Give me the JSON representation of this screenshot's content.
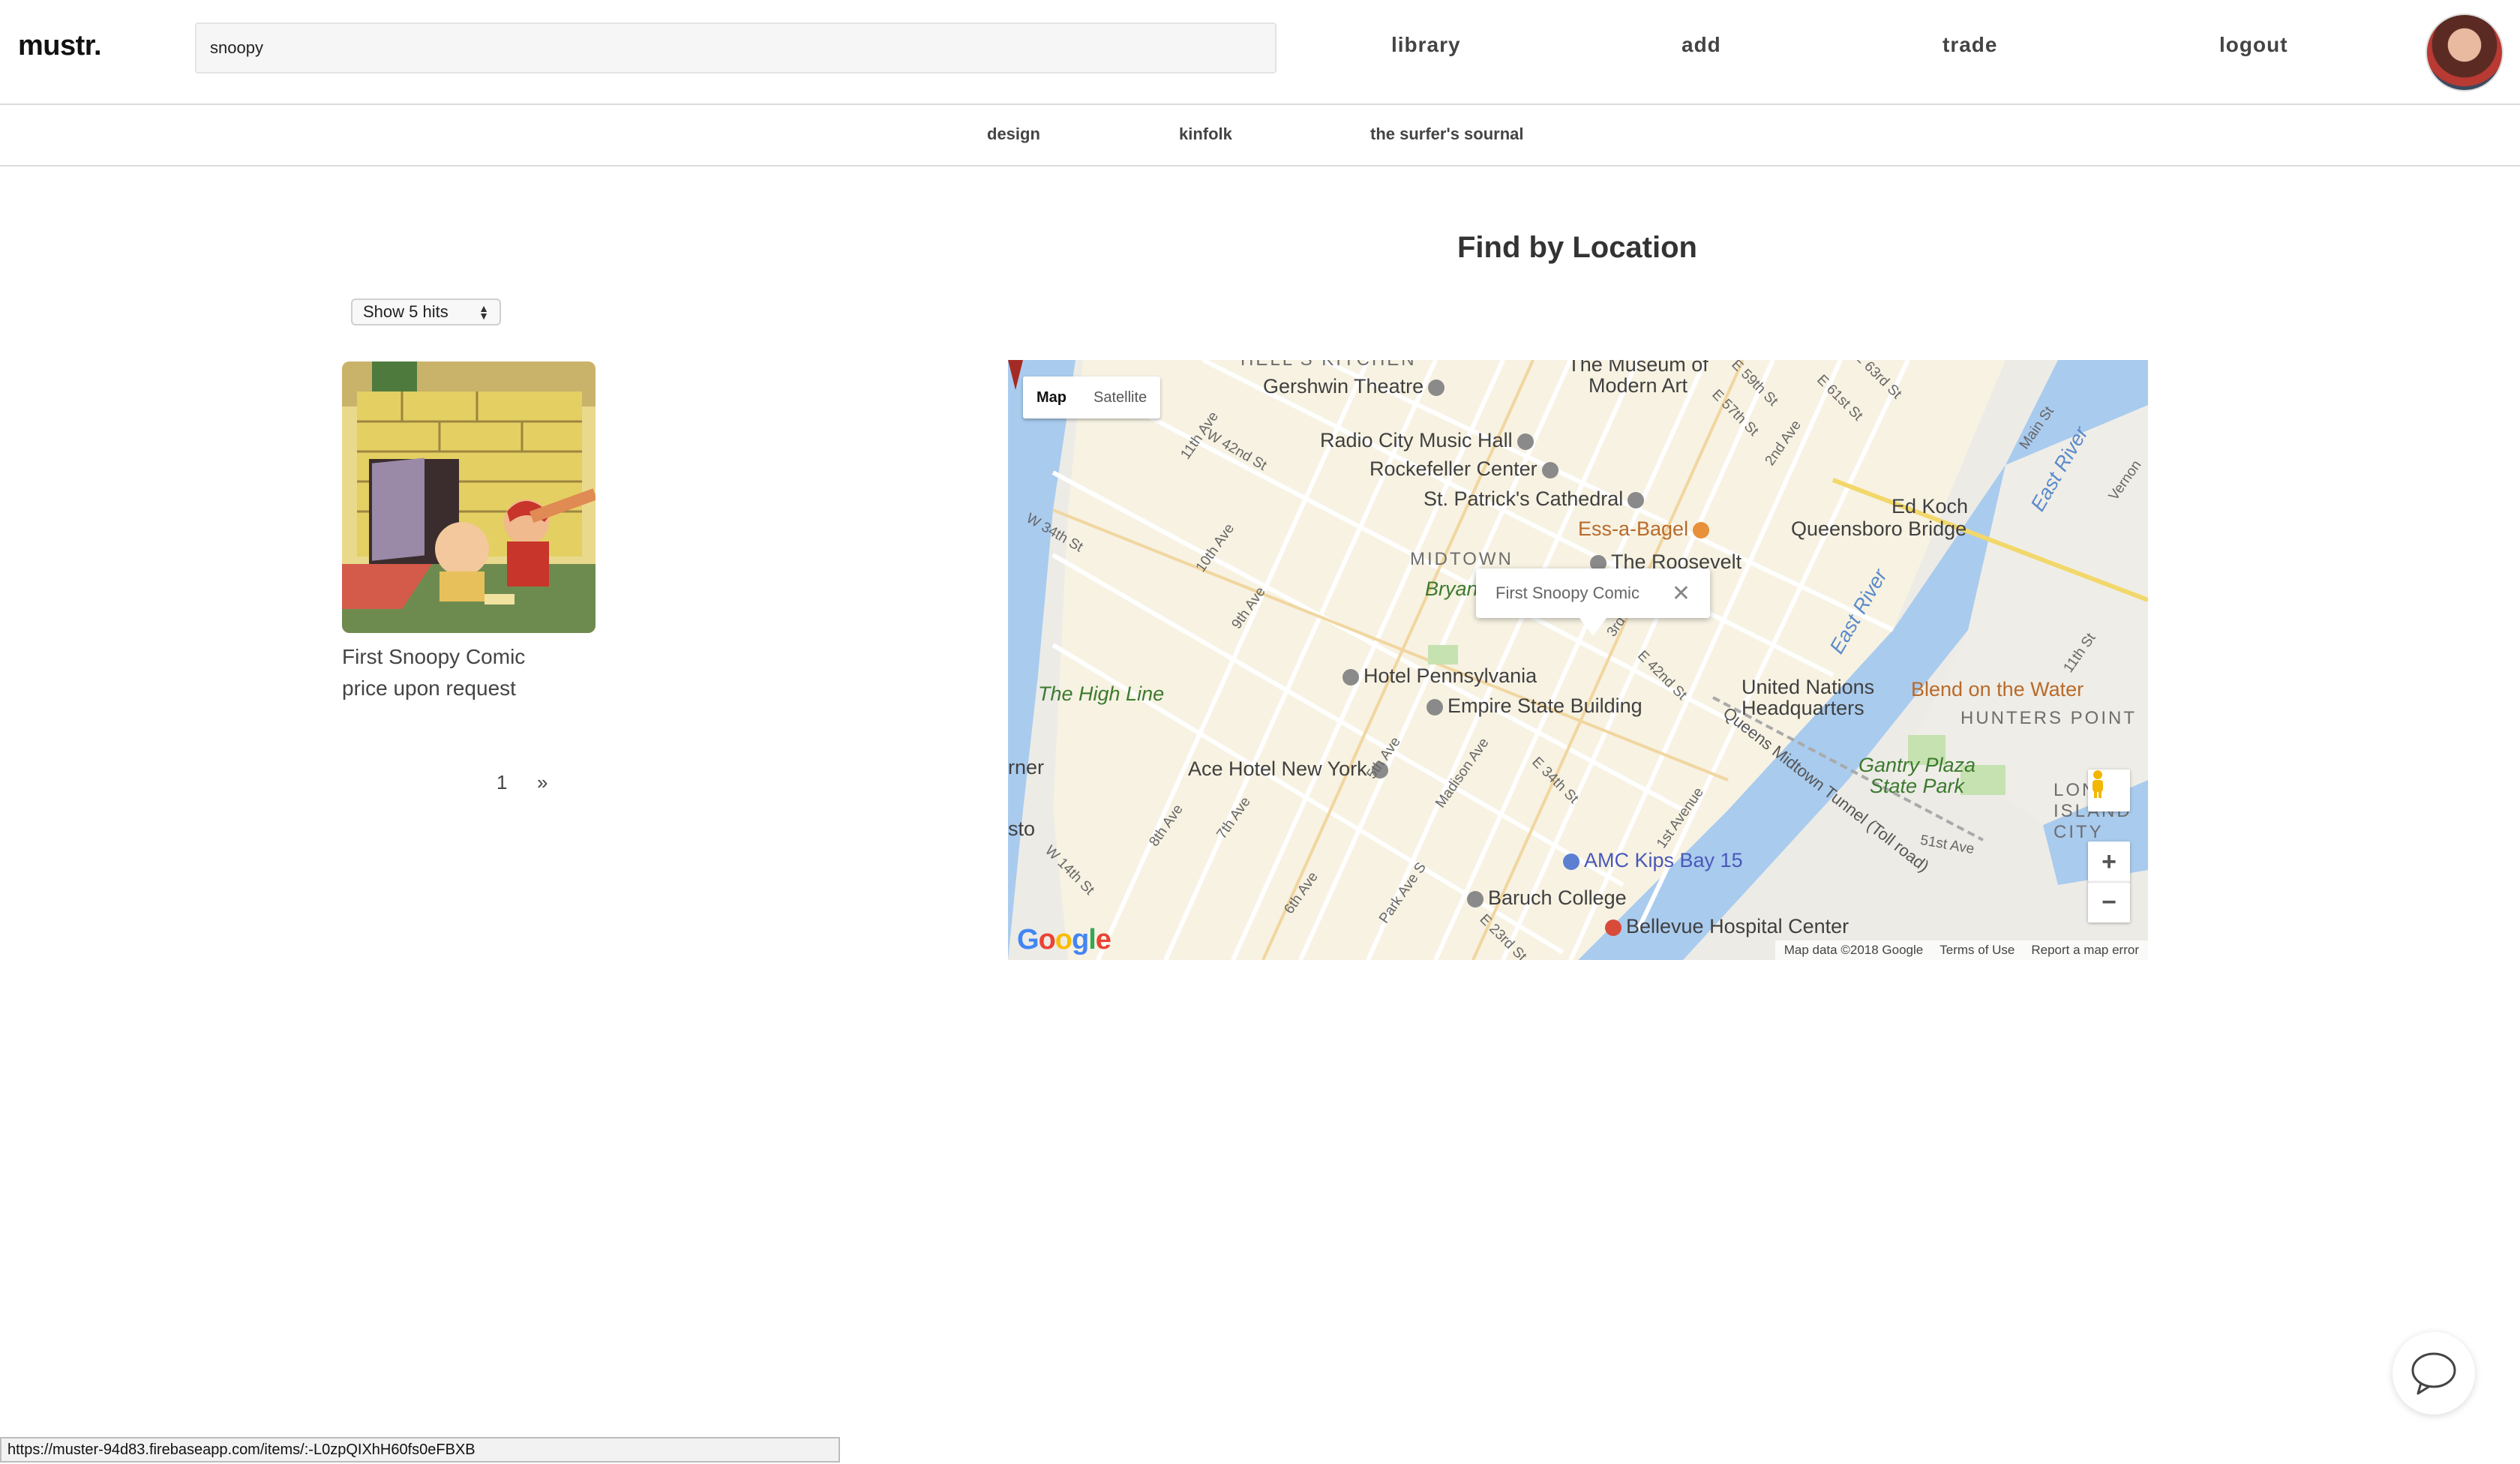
{
  "header": {
    "logo": "mustr.",
    "search_value": "snoopy",
    "nav": [
      "library",
      "add",
      "trade",
      "logout"
    ]
  },
  "subnav": [
    "design",
    "kinfolk",
    "the surfer's sournal"
  ],
  "results": {
    "hits_select": "Show 5 hits",
    "items": [
      {
        "title": "First Snoopy Comic",
        "price": "price upon request"
      }
    ],
    "pagination": {
      "current": "1",
      "next": "»"
    }
  },
  "map": {
    "heading": "Find by Location",
    "type_controls": [
      "Map",
      "Satellite"
    ],
    "infowindow": "First Snoopy Comic",
    "labels": {
      "hells_kitchen": "HELL'S KITCHEN",
      "gershwin": "Gershwin Theatre",
      "moma": "The Museum of Modern Art",
      "radio_city": "Radio City Music Hall",
      "rockefeller": "Rockefeller Center",
      "st_patricks": "St. Patrick's Cathedral",
      "ess_a_bagel": "Ess-a-Bagel",
      "midtown": "MIDTOWN",
      "roosevelt": "The Roosevelt",
      "bryant": "Bryan",
      "hotel_penn": "Hotel Pennsylvania",
      "empire": "Empire State Building",
      "high_line": "The High Line",
      "ace_hotel": "Ace Hotel New York",
      "amc": "AMC Kips Bay 15",
      "baruch": "Baruch College",
      "bellevue": "Bellevue Hospital Center",
      "un": "United Nations Headquarters",
      "queensboro": "Queensboro Bridge",
      "ed_koch": "Ed Koch",
      "blend": "Blend on the Water",
      "hunters_point": "HUNTERS POINT",
      "gantry": "Gantry Plaza State Park",
      "long_island": "LONG ISLAND CITY",
      "east_river": "East River",
      "tunnel": "Queens Midtown Tunnel (Toll road)",
      "turner": "rner",
      "sto": "sto"
    },
    "streets": [
      "W 34th St",
      "W 42nd St",
      "11th Ave",
      "10th Ave",
      "9th Ave",
      "8th Ave",
      "7th Ave",
      "6th Ave",
      "5th Ave",
      "Madison Ave",
      "Park Ave S",
      "3rd Ave",
      "2nd Ave",
      "1st Avenue",
      "E 34th St",
      "E 42nd St",
      "E 57th St",
      "E 59th St",
      "E 61st St",
      "E 63rd St",
      "W 14th St",
      "E 23rd St",
      "51st Ave",
      "11th St",
      "Main St",
      "Vernon"
    ],
    "attribution": [
      "Map data ©2018 Google",
      "Terms of Use",
      "Report a map error"
    ],
    "google_logo": "Google",
    "zoom_in": "+",
    "zoom_out": "−"
  },
  "status_url": "https://muster-94d83.firebaseapp.com/items/:-L0zpQIXhH60fs0eFBXB",
  "colors": {
    "accent": "#333333",
    "water": "#a9cbee",
    "map_land": "#ecebe6",
    "map_block": "#f7f2e2"
  },
  "icons": [
    "avatar",
    "chat-icon",
    "pegman-icon",
    "map-pin-icon",
    "close-icon"
  ]
}
